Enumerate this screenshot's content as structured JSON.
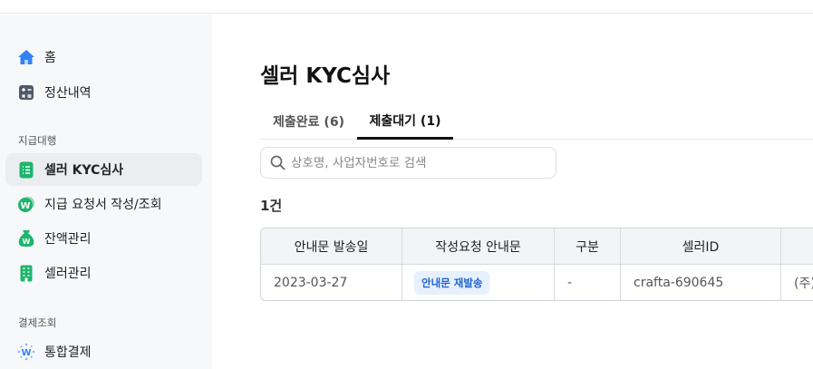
{
  "sidebar": {
    "items": [
      {
        "label": "홈",
        "icon": "home-icon"
      },
      {
        "label": "정산내역",
        "icon": "calculator-icon"
      }
    ],
    "section1": {
      "title": "지급대행",
      "items": [
        {
          "label": "셀러 KYC심사",
          "icon": "document-icon",
          "active": true
        },
        {
          "label": "지급 요청서 작성/조회",
          "icon": "won-coin-icon"
        },
        {
          "label": "잔액관리",
          "icon": "money-bag-icon"
        },
        {
          "label": "셀러관리",
          "icon": "building-icon"
        }
      ]
    },
    "section2": {
      "title": "결제조회",
      "items": [
        {
          "label": "통합결제",
          "icon": "won-sparkle-icon"
        }
      ]
    }
  },
  "main": {
    "title": "셀러 KYC심사",
    "tabs": [
      {
        "label": "제출완료 (6)",
        "active": false
      },
      {
        "label": "제출대기 (1)",
        "active": true
      }
    ],
    "search": {
      "placeholder": "상호명, 사업자번호로 검색",
      "value": ""
    },
    "count": "1건",
    "table": {
      "headers": [
        "안내문 발송일",
        "작성요청 안내문",
        "구분",
        "셀러ID",
        ""
      ],
      "rows": [
        {
          "date": "2023-03-27",
          "notice": "안내문 재발송",
          "type": "-",
          "seller_id": "crafta-690645",
          "company": "(주)"
        }
      ]
    }
  },
  "colors": {
    "accent_blue": "#1f63d3",
    "badge_bg": "#e6f0fe",
    "green_icon": "#1db56c",
    "home_blue": "#3182f6"
  }
}
